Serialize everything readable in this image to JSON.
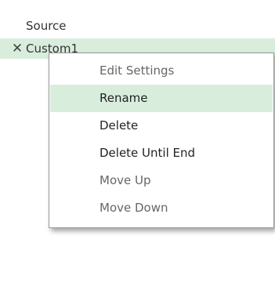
{
  "applied_steps": {
    "items": [
      {
        "label": "Source"
      },
      {
        "label": "Custom1",
        "delete_glyph": "✕"
      }
    ]
  },
  "context_menu": {
    "items": [
      {
        "label": "Edit Settings",
        "enabled": false
      },
      {
        "label": "Rename",
        "enabled": true,
        "highlighted": true
      },
      {
        "label": "Delete",
        "enabled": true
      },
      {
        "label": "Delete Until End",
        "enabled": true
      },
      {
        "label": "Move Up",
        "enabled": false
      },
      {
        "label": "Move Down",
        "enabled": false
      }
    ]
  },
  "colors": {
    "selection": "#d9eddd",
    "menu_border": "#9a9a9a",
    "disabled_text": "#666666"
  }
}
